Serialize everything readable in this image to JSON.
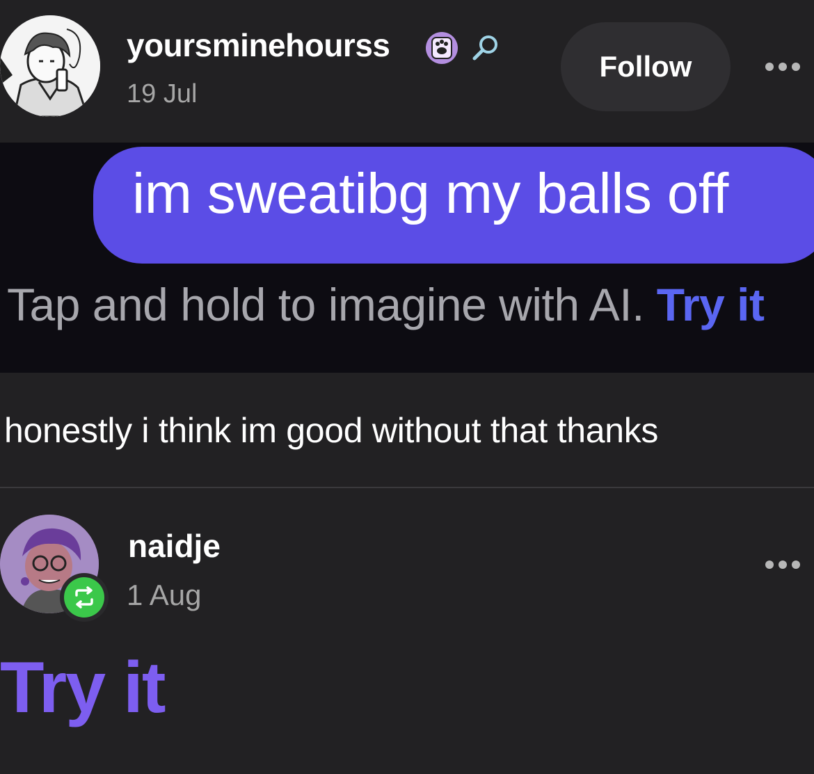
{
  "post": {
    "username": "yoursminehourss",
    "date": "19 Jul",
    "follow_label": "Follow",
    "badges": [
      "paw-badge-icon",
      "search-icon"
    ],
    "embedded_screenshot": {
      "message": "im sweatibg my balls off",
      "hint_text": "Tap and hold to imagine with AI.",
      "hint_link": "Try it"
    },
    "caption": "honestly i think im good without that thanks"
  },
  "reblog": {
    "username": "naidje",
    "date": "1 Aug",
    "text": "Try it"
  },
  "colors": {
    "background": "#222123",
    "bubble": "#5b4de6",
    "link_blue": "#5a66f2",
    "try_it_purple": "#7d5ef0",
    "reblog_green": "#3bc84a"
  }
}
